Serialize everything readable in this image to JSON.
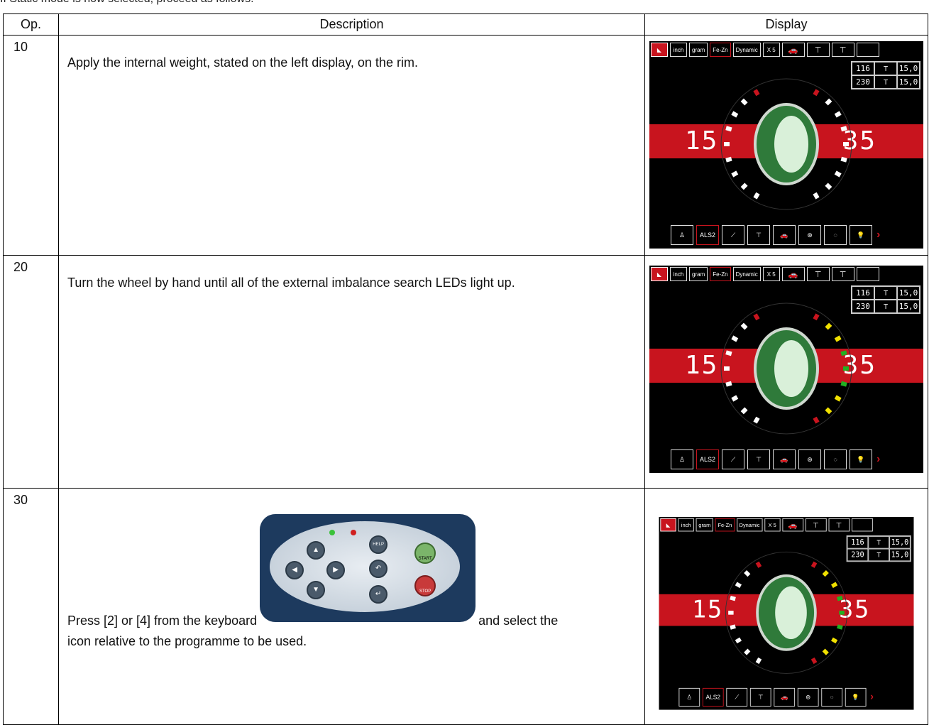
{
  "header_text": "If Static mode is now selected, proceed as follows:",
  "table": {
    "headers": [
      "Op.",
      "Description",
      "Display"
    ],
    "rows": [
      {
        "op": "10",
        "description": "Apply the internal weight, stated on the left display, on the rim."
      },
      {
        "op": "20",
        "description": "Turn the wheel by hand until all of the external imbalance search LEDs light up."
      },
      {
        "op": "30",
        "description_before": "Press [2] or [4] from the keyboard",
        "description_after": "and select the",
        "description_line2": "icon relative to the programme to be used."
      }
    ]
  },
  "display": {
    "top_buttons": [
      "inch",
      "gram",
      "Fe-Zn",
      "Dynamic",
      "X 5"
    ],
    "measures": [
      [
        "116",
        "15,0"
      ],
      [
        "230",
        "15,0"
      ]
    ],
    "left_value": "15",
    "right_value": "35",
    "bottom_label": "ALS2",
    "colors": {
      "red": "#c8141e",
      "yellow": "#f0e000",
      "green": "#22b022",
      "white": "#ffffff"
    }
  },
  "keyboard": {
    "help": "HELP",
    "start": "START",
    "stop": "STOP",
    "back": "BACK",
    "enter": "ENTER"
  }
}
